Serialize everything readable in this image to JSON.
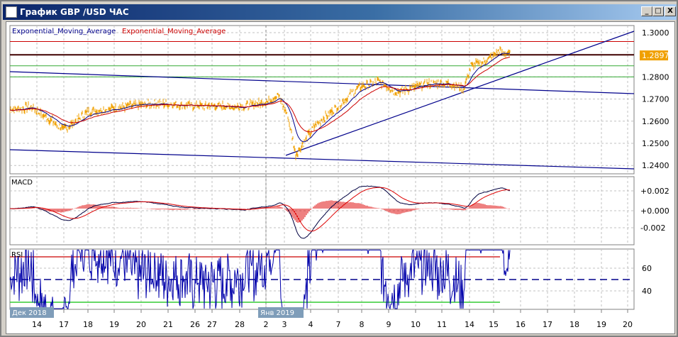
{
  "window": {
    "title": "График GBP /USD  ЧАС",
    "minimize": "_",
    "maximize": "□",
    "close": "X"
  },
  "legend": {
    "ema1": "Exponential_Moving_Average",
    "ema2": "Exponential_Moving_Average"
  },
  "price_axis": {
    "ticks": [
      "1.3000",
      "1.2800",
      "1.2700",
      "1.2600",
      "1.2500",
      "1.2400"
    ],
    "tick_values": [
      1.3,
      1.28,
      1.27,
      1.26,
      1.25,
      1.24
    ],
    "current": "1.2897",
    "current_value": 1.2897
  },
  "levels": {
    "red": 1.296,
    "black": 1.29,
    "green1": 1.285,
    "green2": 1.28
  },
  "macd": {
    "label": "MACD",
    "ticks": [
      "+0.002",
      "+0.000",
      "-0.002"
    ]
  },
  "rsi": {
    "label": "RSI",
    "ticks": [
      "60",
      "40"
    ],
    "upper": 70,
    "lower": 30,
    "mid": 50
  },
  "dates": [
    "14",
    "17",
    "18",
    "19",
    "20",
    "21",
    "26",
    "27",
    "28",
    "2",
    "3",
    "4",
    "7",
    "8",
    "9",
    "10",
    "11",
    "14",
    "15",
    "16",
    "17",
    "18",
    "19",
    "20"
  ],
  "month_labels": [
    "Дек 2018",
    "Янв 2019"
  ],
  "price_keypoints": [
    [
      0,
      1.265
    ],
    [
      30,
      1.2665
    ],
    [
      60,
      1.26
    ],
    [
      75,
      1.256
    ],
    [
      110,
      1.264
    ],
    [
      150,
      1.266
    ],
    [
      200,
      1.268
    ],
    [
      260,
      1.267
    ],
    [
      330,
      1.2665
    ],
    [
      365,
      1.269
    ],
    [
      378,
      1.272
    ],
    [
      392,
      1.262
    ],
    [
      403,
      1.245
    ],
    [
      430,
      1.258
    ],
    [
      460,
      1.266
    ],
    [
      490,
      1.275
    ],
    [
      520,
      1.278
    ],
    [
      545,
      1.273
    ],
    [
      590,
      1.277
    ],
    [
      620,
      1.277
    ],
    [
      640,
      1.275
    ],
    [
      650,
      1.285
    ],
    [
      670,
      1.287
    ],
    [
      690,
      1.292
    ],
    [
      705,
      1.29
    ]
  ],
  "colors": {
    "price": "#f0a000",
    "ema_fast": "#00008b",
    "ema_slow": "#cc0000",
    "accent": "#f0a000"
  }
}
